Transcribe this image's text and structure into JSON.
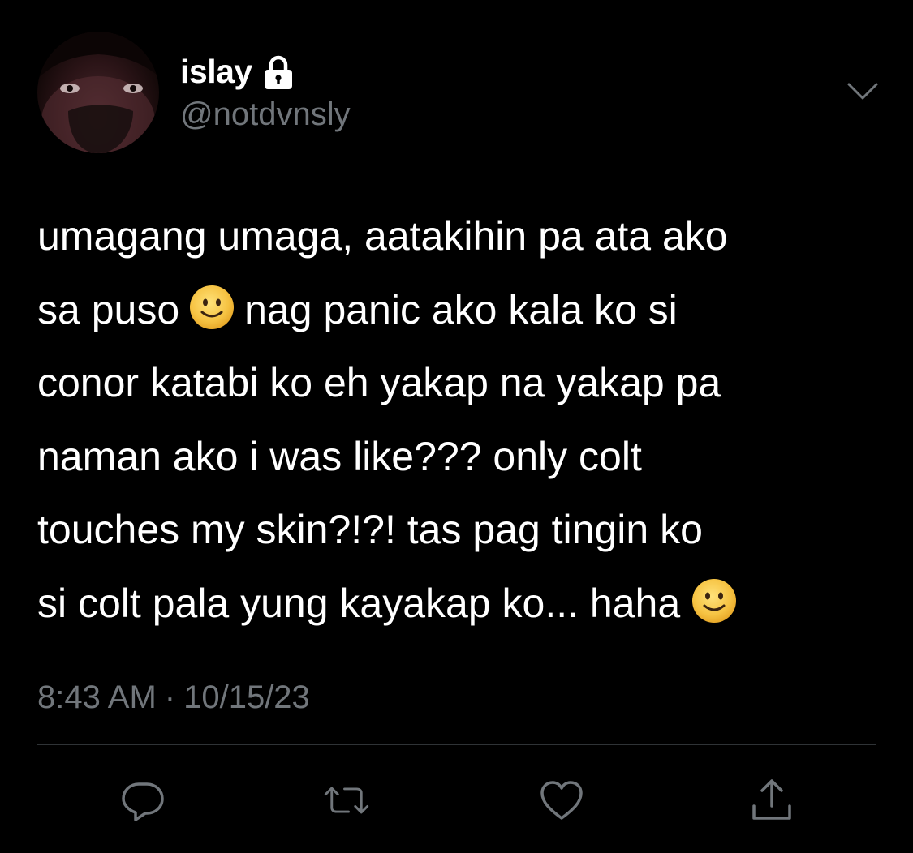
{
  "tweet": {
    "display_name": "islay",
    "handle": "@notdvnsly",
    "lines": [
      [
        "umagang umaga, aatakihin pa ata ako"
      ],
      [
        "sa puso",
        "nag panic ako kala ko si"
      ],
      [
        "conor katabi ko eh yakap na yakap pa"
      ],
      [
        "naman ako i was like??? only colt"
      ],
      [
        "touches my skin?!?! tas pag tingin ko"
      ],
      [
        "si colt pala yung kayakap ko... haha"
      ]
    ],
    "emoji": "slightly-smiling-face",
    "time": "8:43 AM",
    "separator": "·",
    "date": "10/15/23"
  },
  "icons": {
    "lock": "lock-icon",
    "chevron": "chevron-down-icon",
    "reply": "reply-icon",
    "retweet": "retweet-icon",
    "like": "heart-icon",
    "share": "share-icon"
  },
  "colors": {
    "background": "#000000",
    "text": "#ffffff",
    "secondary": "#71767b",
    "divider": "#2f3336",
    "emoji_face": "#f6c343"
  }
}
